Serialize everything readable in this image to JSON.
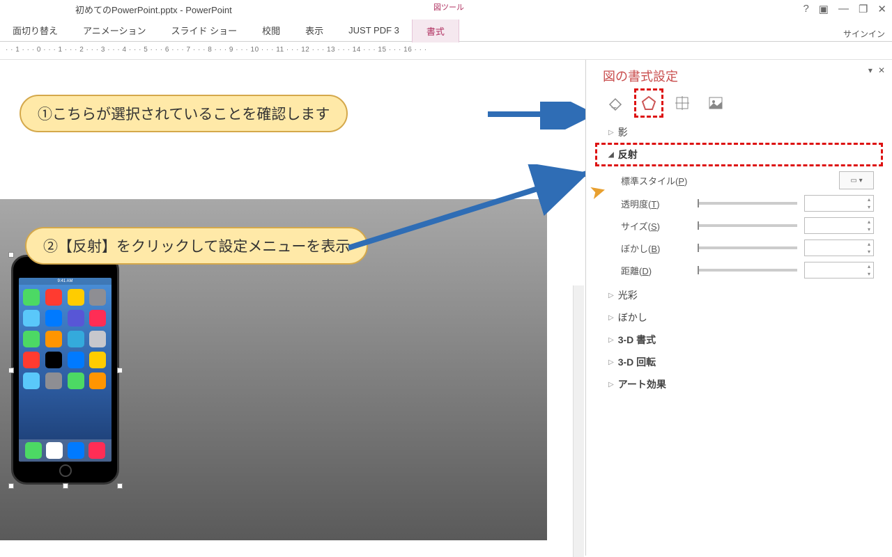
{
  "title": "初めてのPowerPoint.pptx - PowerPoint",
  "tool_context": "図ツール",
  "signin": "サインイン",
  "ribbon_tabs": [
    "面切り替え",
    "アニメーション",
    "スライド ショー",
    "校閲",
    "表示",
    "JUST PDF 3",
    "書式"
  ],
  "ruler": "· · 1 · · · 0 · · · 1 · · · 2 · · · 3 · · · 4 · · · 5 · · · 6 · · · 7 · · · 8 · · · 9 · · · 10 · · · 11 · · · 12 · · · 13 · · · 14 · · · 15 · · · 16 · · ·",
  "callouts": {
    "c1": "①こちらが選択されていることを確認します",
    "c2": "②【反射】をクリックして設定メニューを表示"
  },
  "panel": {
    "title": "図の書式設定",
    "sections": {
      "shadow": "影",
      "reflection": "反射",
      "glow": "光彩",
      "blur": "ぼかし",
      "threeDformat": "3-D 書式",
      "threeDrotate": "3-D 回転",
      "artistic": "アート効果"
    },
    "reflection": {
      "preset": "標準スタイル(",
      "preset_u": "P",
      "transparency": "透明度(",
      "transparency_u": "T",
      "size": "サイズ(",
      "size_u": "S",
      "blur": "ぼかし(",
      "blur_u": "B",
      "distance": "距離(",
      "distance_u": "D",
      "close_paren": ")"
    }
  },
  "phone_status": "9:41 AM",
  "app_colors": [
    "#4cd964",
    "#ff3b30",
    "#ffcc00",
    "#8e8e93",
    "#5ac8fa",
    "#007aff",
    "#5856d6",
    "#ff2d55",
    "#4cd964",
    "#ff9500",
    "#34aadc",
    "#c7c7cc",
    "#ff3b30",
    "#000",
    "#007aff",
    "#ffcc00",
    "#5ac8fa",
    "#8e8e93",
    "#4cd964",
    "#ff9500"
  ],
  "dock_colors": [
    "#4cd964",
    "#fff",
    "#007aff",
    "#ff2d55"
  ]
}
